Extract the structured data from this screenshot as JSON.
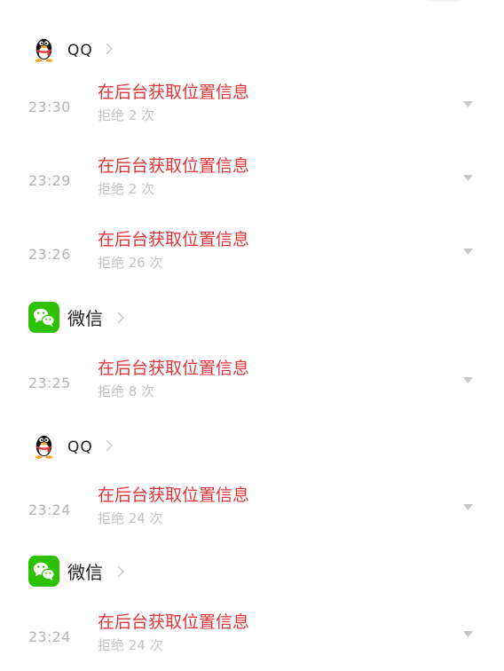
{
  "apps": {
    "qq_1": {
      "name": "QQ",
      "icon": "qq-penguin-icon"
    },
    "wechat_1": {
      "name": "微信",
      "icon": "wechat-icon"
    },
    "qq_2": {
      "name": "QQ",
      "icon": "qq-penguin-icon"
    },
    "wechat_2": {
      "name": "微信",
      "icon": "wechat-icon"
    }
  },
  "records": [
    {
      "time": "23:30",
      "title": "在后台获取位置信息",
      "status": "拒绝 2 次"
    },
    {
      "time": "23:29",
      "title": "在后台获取位置信息",
      "status": "拒绝 2 次"
    },
    {
      "time": "23:26",
      "title": "在后台获取位置信息",
      "status": "拒绝 26 次"
    },
    {
      "time": "23:25",
      "title": "在后台获取位置信息",
      "status": "拒绝 8 次"
    },
    {
      "time": "23:24",
      "title": "在后台获取位置信息",
      "status": "拒绝 24 次"
    },
    {
      "time": "23:24",
      "title": "在后台获取位置信息",
      "status": "拒绝 24 次"
    }
  ],
  "colors": {
    "title_red": "#e0363a",
    "time_gray": "#b4b4b4",
    "status_gray": "#c2c2c2",
    "wechat_green": "#2dc100"
  }
}
